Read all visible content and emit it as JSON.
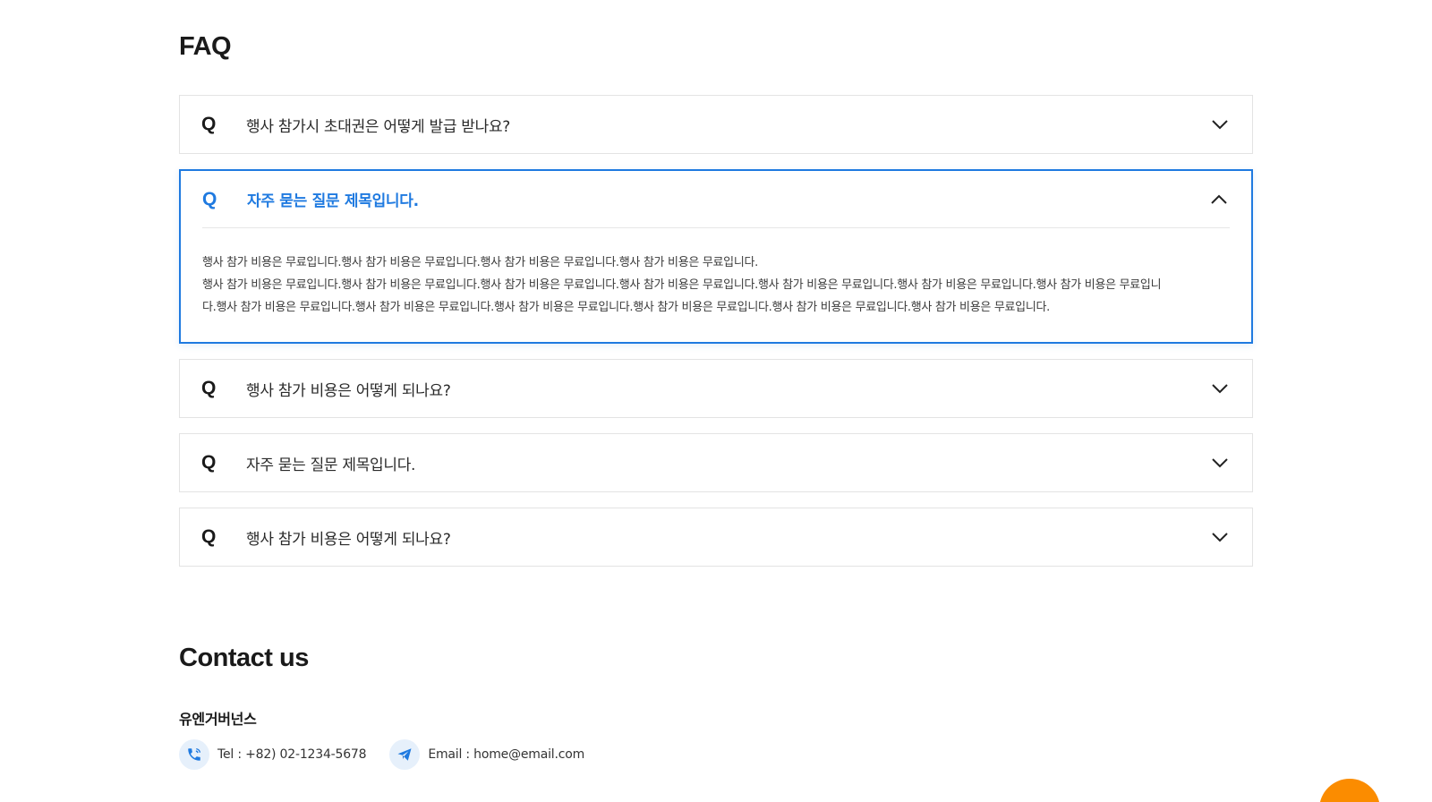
{
  "faq": {
    "title": "FAQ",
    "items": [
      {
        "q": "Q",
        "question": "행사 참가시 초대권은 어떻게 발급 받나요?",
        "open": false
      },
      {
        "q": "Q",
        "question": "자주 묻는 질문 제목입니다.",
        "open": true,
        "answer_lines": [
          "행사 참가 비용은 무료입니다.행사 참가 비용은 무료입니다.행사 참가 비용은 무료입니다.행사 참가 비용은 무료입니다.",
          "행사 참가 비용은 무료입니다.행사 참가 비용은 무료입니다.행사 참가 비용은 무료입니다.행사 참가 비용은 무료입니다.행사 참가 비용은 무료입니다.행사 참가 비용은 무료입니다.행사 참가 비용은 무료입니다.행사 참가 비용은 무료입니다.행사 참가 비용은 무료입니다.행사 참가 비용은 무료입니다.행사 참가 비용은 무료입니다.행사 참가 비용은 무료입니다.행사 참가 비용은 무료입니다."
        ]
      },
      {
        "q": "Q",
        "question": "행사 참가 비용은 어떻게 되나요?",
        "open": false
      },
      {
        "q": "Q",
        "question": "자주 묻는 질문 제목입니다.",
        "open": false
      },
      {
        "q": "Q",
        "question": "행사 참가 비용은 어떻게 되나요?",
        "open": false
      }
    ]
  },
  "contact": {
    "title": "Contact us",
    "company": "유엔거버넌스",
    "tel": "Tel : +82) 02-1234-5678",
    "email": "Email : home@email.com",
    "tel_icon": "phone-icon",
    "email_icon": "email-icon"
  },
  "colors": {
    "accent": "#1f7ae0",
    "fab": "#fb8c00"
  }
}
